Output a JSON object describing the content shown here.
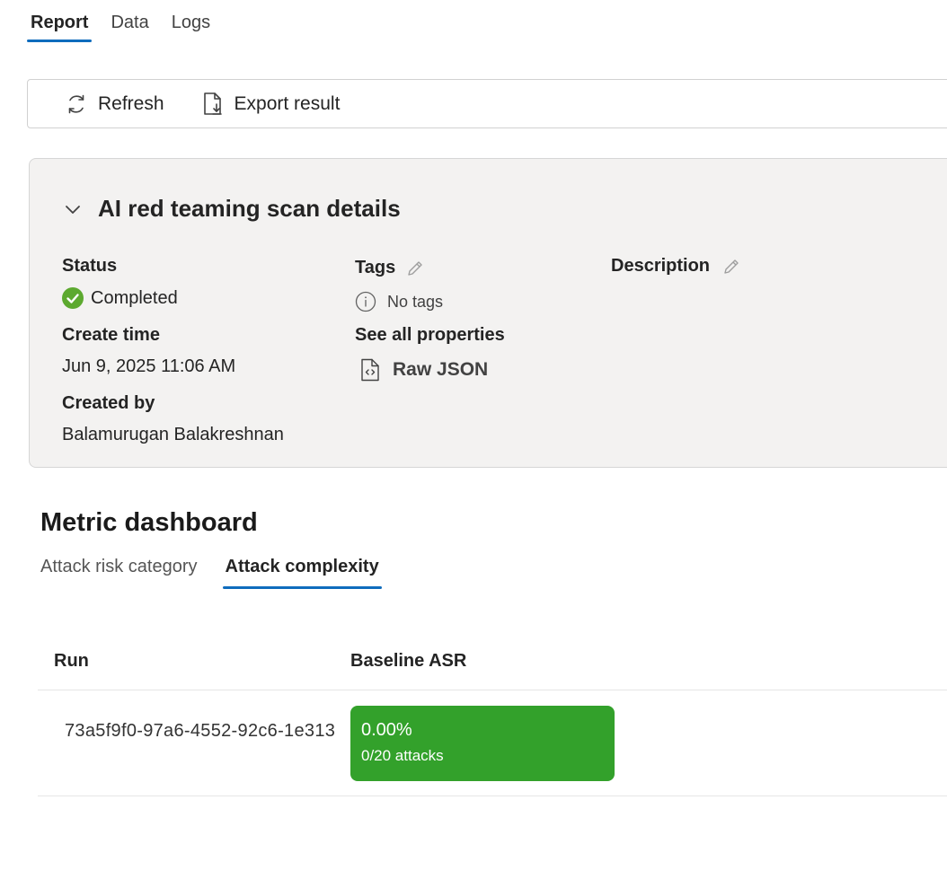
{
  "tabs": [
    {
      "label": "Report",
      "active": true
    },
    {
      "label": "Data",
      "active": false
    },
    {
      "label": "Logs",
      "active": false
    }
  ],
  "toolbar": {
    "refresh_label": "Refresh",
    "export_label": "Export result",
    "refresh_icon": "refresh-icon",
    "export_icon": "export-document-icon"
  },
  "details": {
    "title": "AI red teaming scan details",
    "status_label": "Status",
    "status_value": "Completed",
    "create_time_label": "Create time",
    "create_time_value": "Jun 9, 2025 11:06 AM",
    "created_by_label": "Created by",
    "created_by_value": "Balamurugan Balakreshnan",
    "tags_label": "Tags",
    "no_tags_text": "No tags",
    "see_all_label": "See all properties",
    "raw_json_label": "Raw JSON",
    "description_label": "Description"
  },
  "metric_dashboard": {
    "title": "Metric dashboard",
    "tabs": [
      {
        "label": "Attack risk category",
        "active": false
      },
      {
        "label": "Attack complexity",
        "active": true
      }
    ],
    "columns": [
      "Run",
      "Baseline ASR"
    ],
    "rows": [
      {
        "run": "73a5f9f0-97a6-4552-92c6-1e313",
        "baseline_asr": "0.00%",
        "baseline_attacks": "0/20 attacks"
      }
    ]
  },
  "colors": {
    "accent": "#0f6cbd",
    "success": "#33a12b",
    "status_green": "#5ca92f",
    "panel_bg": "#f3f2f1"
  }
}
